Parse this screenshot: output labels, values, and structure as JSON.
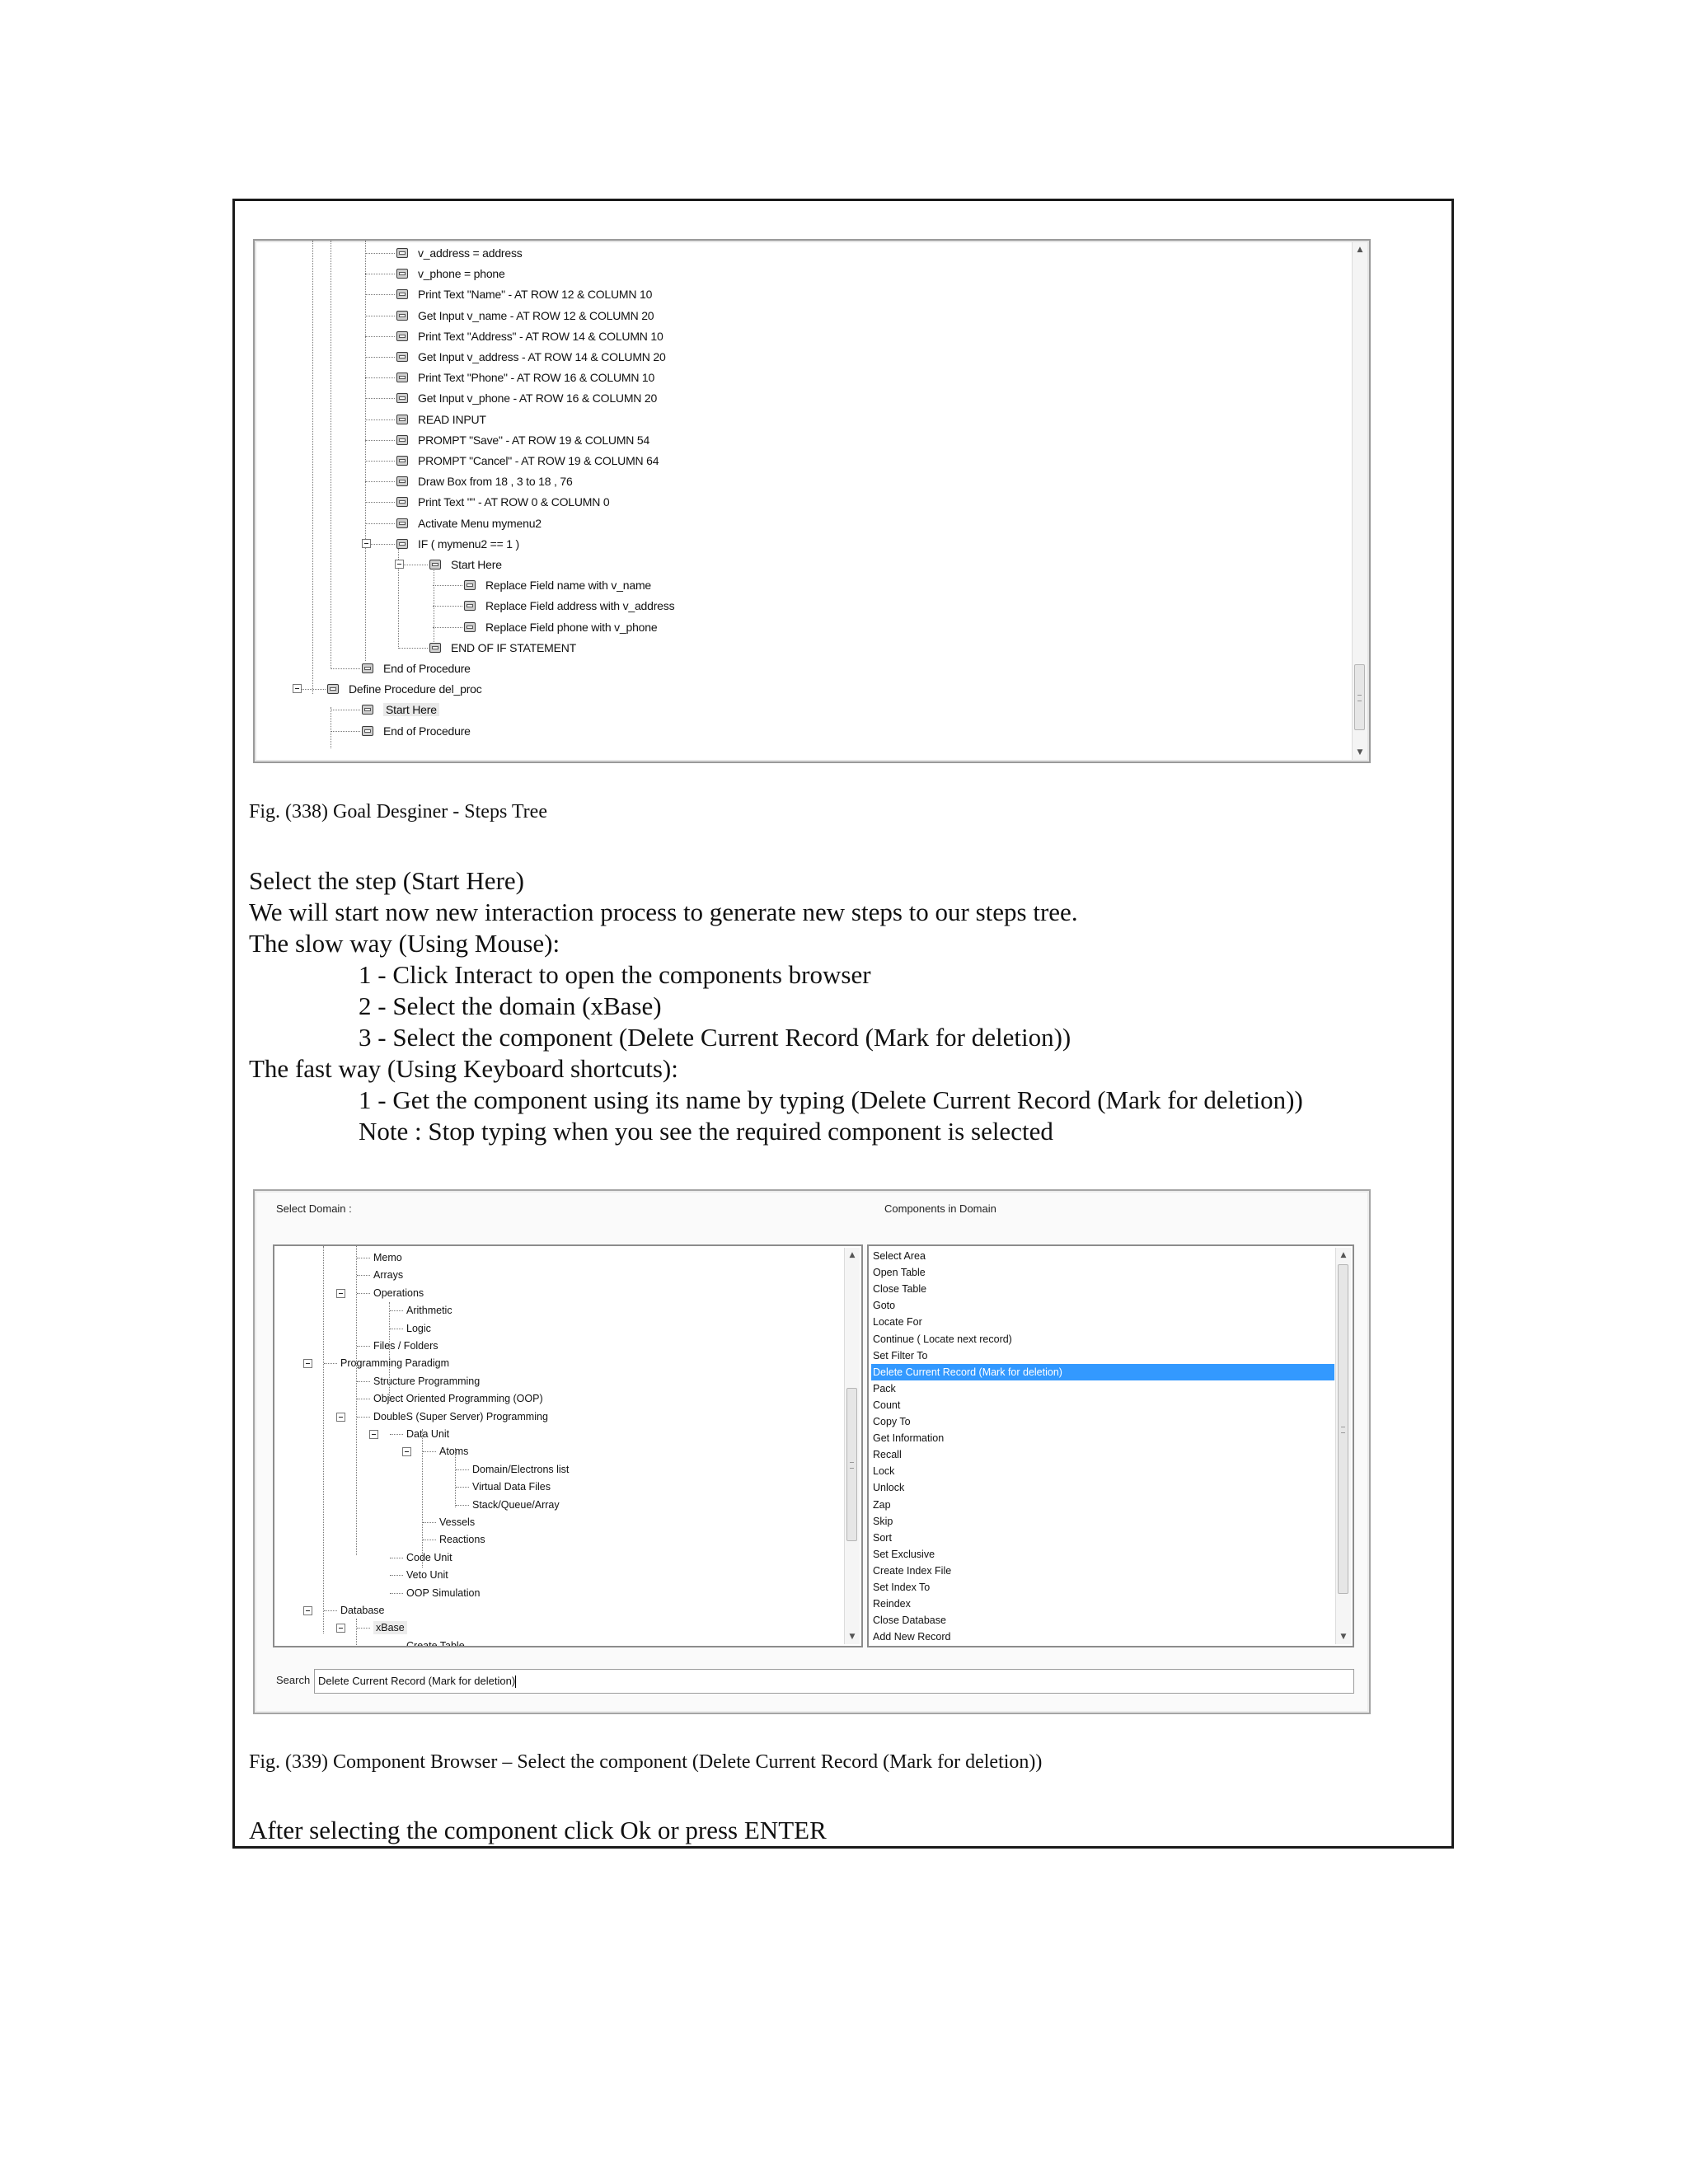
{
  "fig1": {
    "tree": [
      {
        "text": "v_address = address"
      },
      {
        "text": "v_phone = phone"
      },
      {
        "text": "Print Text \"Name\" - AT ROW 12 & COLUMN 10"
      },
      {
        "text": "Get Input v_name - AT ROW 12 & COLUMN 20"
      },
      {
        "text": "Print Text \"Address\" - AT ROW 14 & COLUMN 10"
      },
      {
        "text": "Get Input v_address - AT ROW 14 & COLUMN 20"
      },
      {
        "text": "Print Text \"Phone\" - AT ROW 16 & COLUMN 10"
      },
      {
        "text": "Get Input v_phone - AT ROW 16 & COLUMN 20"
      },
      {
        "text": "READ INPUT"
      },
      {
        "text": "PROMPT \"Save\" - AT ROW 19 & COLUMN 54"
      },
      {
        "text": "PROMPT \"Cancel\" - AT ROW 19 & COLUMN 64"
      },
      {
        "text": "Draw Box from 18 , 3 to 18 , 76"
      },
      {
        "text": "Print Text \"\" - AT ROW 0 & COLUMN 0"
      },
      {
        "text": "Activate Menu mymenu2"
      },
      {
        "text": "IF ( mymenu2 == 1 )"
      },
      {
        "text": "Start Here"
      },
      {
        "text": "Replace Field name with v_name"
      },
      {
        "text": "Replace Field address with v_address"
      },
      {
        "text": "Replace Field phone with v_phone"
      },
      {
        "text": "END OF IF STATEMENT"
      },
      {
        "text": "End of Procedure"
      },
      {
        "text": "Define Procedure del_proc"
      },
      {
        "text": "Start Here"
      },
      {
        "text": "End of Procedure"
      }
    ],
    "caption": "Fig. (338) Goal Desginer - Steps Tree"
  },
  "body": {
    "l1": "Select the step (Start Here)",
    "l2": "We will start now new interaction process to generate new steps to our steps tree.",
    "l3": "The slow way (Using Mouse):",
    "l4": "1 - Click Interact to open the components browser",
    "l5": "2 - Select the domain (xBase)",
    "l6": "3 - Select the component (Delete Current Record (Mark for deletion))",
    "l7": "The fast way (Using Keyboard shortcuts):",
    "l8": "1 - Get the component using its name by typing (Delete Current Record (Mark for deletion))",
    "l9": "Note : Stop typing when you see the required component is selected"
  },
  "fig2": {
    "select_domain_label": "Select Domain :",
    "components_label": "Components in Domain",
    "domain_tree": [
      {
        "text": "Memo"
      },
      {
        "text": "Arrays"
      },
      {
        "text": "Operations"
      },
      {
        "text": "Arithmetic"
      },
      {
        "text": "Logic"
      },
      {
        "text": "Files / Folders"
      },
      {
        "text": "Programming Paradigm"
      },
      {
        "text": "Structure Programming"
      },
      {
        "text": "Object Oriented Programming (OOP)"
      },
      {
        "text": "DoubleS (Super Server) Programming"
      },
      {
        "text": "Data Unit"
      },
      {
        "text": "Atoms"
      },
      {
        "text": "Domain/Electrons list"
      },
      {
        "text": "Virtual Data Files"
      },
      {
        "text": "Stack/Queue/Array"
      },
      {
        "text": "Vessels"
      },
      {
        "text": "Reactions"
      },
      {
        "text": "Code Unit"
      },
      {
        "text": "Veto Unit"
      },
      {
        "text": "OOP Simulation"
      },
      {
        "text": "Database"
      },
      {
        "text": "xBase"
      },
      {
        "text": "Create Table"
      }
    ],
    "components": [
      "Select Area",
      "Open Table",
      "Close Table",
      "Goto",
      "Locate For",
      "Continue ( Locate next record)",
      "Set Filter To",
      "Delete Current Record (Mark for deletion)",
      "Pack",
      "Count",
      "Copy To",
      "Get Information",
      "Recall",
      "Lock",
      "Unlock",
      "Zap",
      "Skip",
      "Sort",
      "Set Exclusive",
      "Create Index File",
      "Set Index To",
      "Reindex",
      "Close Database",
      "Add New Record"
    ],
    "selected_component": "Delete Current Record (Mark for deletion)",
    "search_label": "Search",
    "search_value": "Delete Current Record (Mark for deletion)",
    "caption": "Fig. (339) Component Browser – Select the component (Delete Current Record (Mark for deletion))"
  },
  "footer_text": "After selecting the component click Ok or press ENTER"
}
